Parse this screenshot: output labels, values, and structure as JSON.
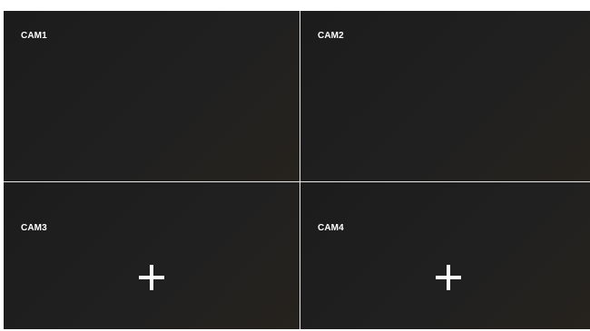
{
  "cameras": [
    {
      "label": "CAM1",
      "has_add": false
    },
    {
      "label": "CAM2",
      "has_add": false
    },
    {
      "label": "CAM3",
      "has_add": true,
      "add_icon": "plus-icon"
    },
    {
      "label": "CAM4",
      "has_add": true,
      "add_icon": "plus-icon"
    }
  ],
  "colors": {
    "cell_background": "#1f1f1f",
    "divider": "#e8e8e8",
    "label_text": "#ffffff",
    "add_icon": "#ffffff"
  }
}
